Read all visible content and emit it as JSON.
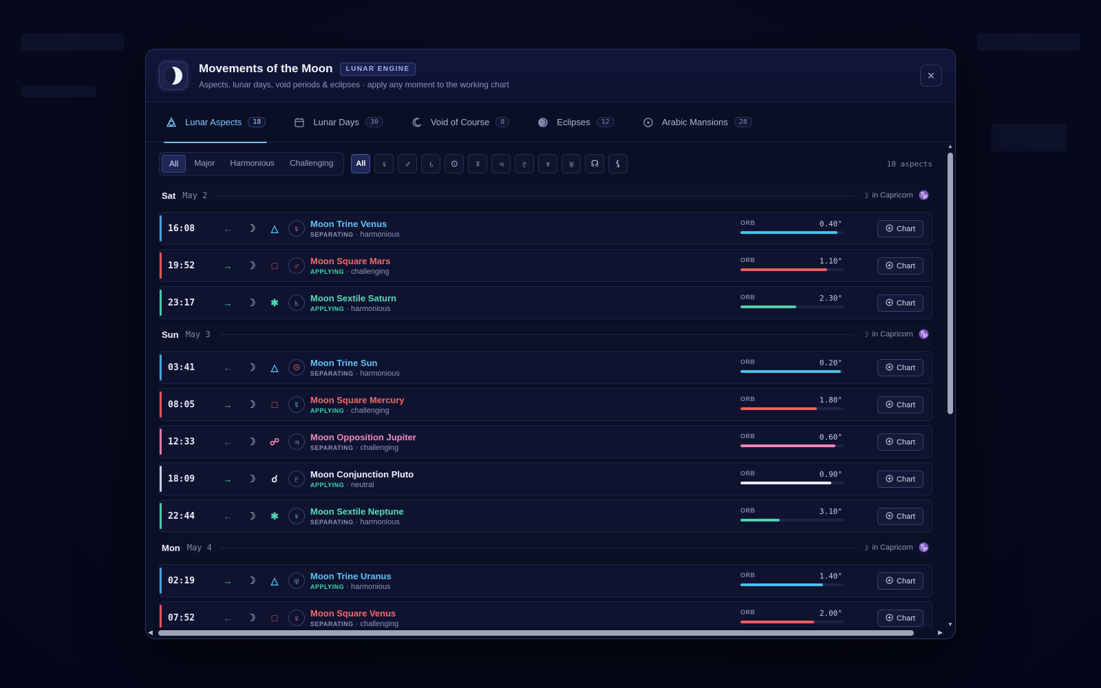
{
  "modal": {
    "title": "Movements of the Moon",
    "badge": "LUNAR ENGINE",
    "subtitle": "Aspects, lunar days, void periods & eclipses · apply any moment to the working chart",
    "close_icon": "×"
  },
  "tabs": [
    {
      "label": "Lunar Aspects",
      "count": "18",
      "icon": "moon-aspects-icon",
      "active": true
    },
    {
      "label": "Lunar Days",
      "count": "30",
      "icon": "calendar-icon",
      "active": false
    },
    {
      "label": "Void of Course",
      "count": "8",
      "icon": "crescent-icon",
      "active": false
    },
    {
      "label": "Eclipses",
      "count": "12",
      "icon": "eclipse-icon",
      "active": false
    },
    {
      "label": "Arabic Mansions",
      "count": "28",
      "icon": "mansion-icon",
      "active": false
    }
  ],
  "filters": {
    "types": [
      {
        "label": "All",
        "on": true
      },
      {
        "label": "Major",
        "on": false
      },
      {
        "label": "Harmonious",
        "on": false
      },
      {
        "label": "Challenging",
        "on": false
      }
    ],
    "planets": [
      {
        "glyph": "All",
        "on": true
      },
      {
        "glyph": "♀"
      },
      {
        "glyph": "♂"
      },
      {
        "glyph": "♄"
      },
      {
        "glyph": "⊙"
      },
      {
        "glyph": "☿"
      },
      {
        "glyph": "♃"
      },
      {
        "glyph": "♇"
      },
      {
        "glyph": "♆"
      },
      {
        "glyph": "♅"
      },
      {
        "glyph": "☊"
      },
      {
        "glyph": "⚸"
      }
    ],
    "count_label": "18 aspects"
  },
  "orb_label": "ORB",
  "chart_label": "Chart",
  "days": [
    {
      "name": "Sat",
      "date": "May 2",
      "sign_text": "in Capricorn",
      "sign_glyph": "♑",
      "moon": "☽",
      "rows": [
        {
          "time": "16:08",
          "dir": "←",
          "dir_color": "#6a7292",
          "aspect": "△",
          "aspect_color": "#57bdf2",
          "planet": "♀",
          "planet_color": "#f08ab8",
          "title": "Moon Trine Venus",
          "title_color": "#5ec3f5",
          "status": "SEPARATING",
          "status_color": "#8a92b2",
          "nature": "harmonious",
          "orb": "0.40°",
          "orb_fraction": 0.94,
          "bar_color": "#4cc0f0",
          "accent": "#4a9fd6"
        },
        {
          "time": "19:52",
          "dir": "→",
          "dir_color": "#3fd6a8",
          "aspect": "□",
          "aspect_color": "#f0605e",
          "planet": "♂",
          "planet_color": "#f0605e",
          "title": "Moon Square Mars",
          "title_color": "#f26a66",
          "status": "APPLYING",
          "status_color": "#3fd6a8",
          "nature": "challenging",
          "orb": "1.10°",
          "orb_fraction": 0.84,
          "bar_color": "#ef5f5c",
          "accent": "#e0555a"
        },
        {
          "time": "23:17",
          "dir": "→",
          "dir_color": "#3fd6a8",
          "aspect": "✱",
          "aspect_color": "#4fd6b0",
          "planet": "♄",
          "planet_color": "#c9cfe4",
          "title": "Moon Sextile Saturn",
          "title_color": "#56dcb8",
          "status": "APPLYING",
          "status_color": "#3fd6a8",
          "nature": "harmonious",
          "orb": "2.30°",
          "orb_fraction": 0.54,
          "bar_color": "#4ed2b0",
          "accent": "#47c9a8"
        }
      ]
    },
    {
      "name": "Sun",
      "date": "May 3",
      "sign_text": "in Capricorn",
      "sign_glyph": "♑",
      "moon": "☽",
      "rows": [
        {
          "time": "03:41",
          "dir": "←",
          "dir_color": "#6a7292",
          "aspect": "△",
          "aspect_color": "#57bdf2",
          "planet": "⊙",
          "planet_color": "#f0605e",
          "title": "Moon Trine Sun",
          "title_color": "#5ec3f5",
          "status": "SEPARATING",
          "status_color": "#8a92b2",
          "nature": "harmonious",
          "orb": "0.20°",
          "orb_fraction": 0.97,
          "bar_color": "#4cc0f0",
          "accent": "#4a9fd6"
        },
        {
          "time": "08:05",
          "dir": "→",
          "dir_color": "#3fd6a8",
          "aspect": "□",
          "aspect_color": "#f0605e",
          "planet": "☿",
          "planet_color": "#55d6c0",
          "title": "Moon Square Mercury",
          "title_color": "#f26a66",
          "status": "APPLYING",
          "status_color": "#3fd6a8",
          "nature": "challenging",
          "orb": "1.80°",
          "orb_fraction": 0.74,
          "bar_color": "#ef5f5c",
          "accent": "#e0555a"
        },
        {
          "time": "12:33",
          "dir": "←",
          "dir_color": "#6a7292",
          "aspect": "☍",
          "aspect_color": "#f08ab8",
          "planet": "♃",
          "planet_color": "#9bb4ff",
          "title": "Moon Opposition Jupiter",
          "title_color": "#f08ab8",
          "status": "SEPARATING",
          "status_color": "#8a92b2",
          "nature": "challenging",
          "orb": "0.60°",
          "orb_fraction": 0.92,
          "bar_color": "#f08ab8",
          "accent": "#e07aa8"
        },
        {
          "time": "18:09",
          "dir": "→",
          "dir_color": "#3fd6a8",
          "aspect": "☌",
          "aspect_color": "#e7ebf8",
          "planet": "♇",
          "planet_color": "#9bb4ff",
          "title": "Moon Conjunction Pluto",
          "title_color": "#eef1fb",
          "status": "APPLYING",
          "status_color": "#3fd6a8",
          "nature": "neutral",
          "orb": "0.90°",
          "orb_fraction": 0.88,
          "bar_color": "#e7eaf5",
          "accent": "#c7cbe0"
        },
        {
          "time": "22:44",
          "dir": "←",
          "dir_color": "#6a7292",
          "aspect": "✱",
          "aspect_color": "#4fd6b0",
          "planet": "♆",
          "planet_color": "#6cc3f5",
          "title": "Moon Sextile Neptune",
          "title_color": "#56dcb8",
          "status": "SEPARATING",
          "status_color": "#8a92b2",
          "nature": "harmonious",
          "orb": "3.10°",
          "orb_fraction": 0.38,
          "bar_color": "#4ed2b0",
          "accent": "#47c9a8"
        }
      ]
    },
    {
      "name": "Mon",
      "date": "May 4",
      "sign_text": "in Capricorn",
      "sign_glyph": "♑",
      "moon": "☽",
      "rows": [
        {
          "time": "02:19",
          "dir": "→",
          "dir_color": "#3fd6a8",
          "aspect": "△",
          "aspect_color": "#57bdf2",
          "planet": "♅",
          "planet_color": "#6cc3f5",
          "title": "Moon Trine Uranus",
          "title_color": "#5ec3f5",
          "status": "APPLYING",
          "status_color": "#3fd6a8",
          "nature": "harmonious",
          "orb": "1.40°",
          "orb_fraction": 0.8,
          "bar_color": "#4cc0f0",
          "accent": "#4a9fd6"
        },
        {
          "time": "07:52",
          "dir": "←",
          "dir_color": "#6a7292",
          "aspect": "□",
          "aspect_color": "#f0605e",
          "planet": "♀",
          "planet_color": "#f08ab8",
          "title": "Moon Square Venus",
          "title_color": "#f26a66",
          "status": "SEPARATING",
          "status_color": "#8a92b2",
          "nature": "challenging",
          "orb": "2.00°",
          "orb_fraction": 0.71,
          "bar_color": "#ef5f5c",
          "accent": "#e0555a"
        }
      ]
    }
  ]
}
